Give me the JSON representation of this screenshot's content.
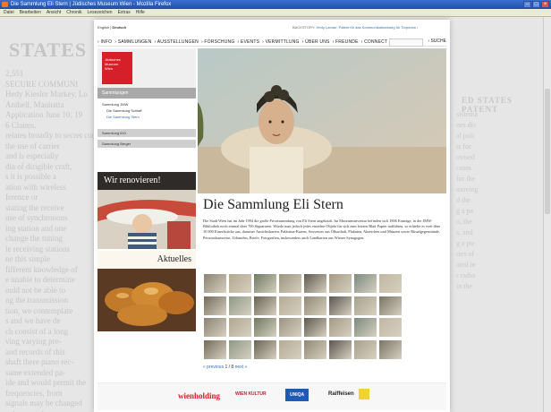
{
  "window": {
    "title": "Die Sammlung Eli Stern | Jüdisches Museum Wien - Mozilla Firefox"
  },
  "menubar": [
    "Datei",
    "Bearbeiten",
    "Ansicht",
    "Chronik",
    "Lesezeichen",
    "Extras",
    "Hilfe"
  ],
  "background_doc": {
    "left_big": "STATES",
    "left_lines": [
      "2,551",
      "SECURE COMMUNI",
      "Hedy Kiesler Markey, Lo",
      "Antheil, Manhatta",
      "Application June 10, 19",
      "6 Claims.",
      "relates broadly to secret com",
      "the use of carrier",
      "and is especially",
      "dia of dirigible craft,",
      "s it is possible a",
      "ation with wireless",
      "ference or",
      "stating the receive",
      "use of synchronous",
      "ing station and one",
      "change the tuning",
      "le receiving stations",
      "ne this simple",
      "fifferent knowledge of",
      "e unable to determine",
      "ould not be able to",
      "ng the transmission",
      "tion, we contemplate",
      "s and we have de",
      "ch consist of a long",
      "ving varying pre-",
      "and records of this",
      "shaft there piano rec-",
      "same extended pa-",
      "ide and would permit the",
      "frequencies, from",
      "signals may be changed",
      "s the same frequency"
    ],
    "right_big": "ED STATES PATENT",
    "right_lines": [
      "sistema",
      "nes dis",
      "al poli",
      "ts for",
      "ovised",
      "cases",
      "for the",
      "moving",
      "d the",
      "g a pa",
      "o, the",
      "s, and",
      "g a pu-",
      "ries of",
      "ated in",
      "r radio",
      "in the"
    ]
  },
  "header": {
    "lang_current": "English",
    "lang_other": "Deutsch",
    "backstory_label": "BACKSTORY:",
    "backstory_link": "Hedy Lamarr, Patent für das Kommunikationsweg für Torpedos"
  },
  "nav": {
    "items": [
      "INFO",
      "SAMMLUNGEN",
      "AUSSTELLUNGEN",
      "FORSCHUNG",
      "EVENTS",
      "VERMITTLUNG",
      "ÜBER UNS",
      "FREUNDE",
      "CONNECT"
    ],
    "search_label": "SUCHE"
  },
  "sidebar": {
    "logo_lines": [
      "Jüdisches",
      "Museum",
      "Wien"
    ],
    "section_title": "Sammlungen",
    "items": [
      "Sammlung JMW",
      "Die Sammlung Schlaff",
      "Die Sammlung Stern",
      "Sammlung IKG",
      "Sammlung Berger"
    ],
    "promo_title": "Wir renovieren!",
    "aktuelles_title": "Aktuelles"
  },
  "main": {
    "title": "Die Sammlung Eli Stern",
    "body": "Die Stadt Wien hat im Jahr 1994 die große Privatsammlung von Eli Stern angekauft. Im Museumsinventar befinden sich 1806 Einträge, in der JMW-Bibliothek noch einmal über 700 Signaturen. Würde man jedoch jedes einzelne Objekt für sich zum letzten Blatt Papier aufführen, so erhielte es weit über 10 000 Einzelstücke aus, darunter Ansichtskarten, Palästina-Karten, Souvenirs aus Ölbarthalt, Plakaten, Abzeichen und Münzen sowie Ritualgegenstände, Personalausweise, Urkunden, Briefe, Fotografien, insbesonders auch Landkarten aus Wiener Synagogen.",
    "pager": {
      "prev": "« previous",
      "current": "1 / 8",
      "next": "next »"
    }
  },
  "footer": {
    "sponsors": [
      "wienholding",
      "WIEN KULTUR",
      "UNIQA",
      "Raiffeisen"
    ]
  },
  "colors": {
    "accent_red": "#d5202a",
    "link_blue": "#3a6fb3",
    "titlebar_blue": "#1f4fa8"
  }
}
